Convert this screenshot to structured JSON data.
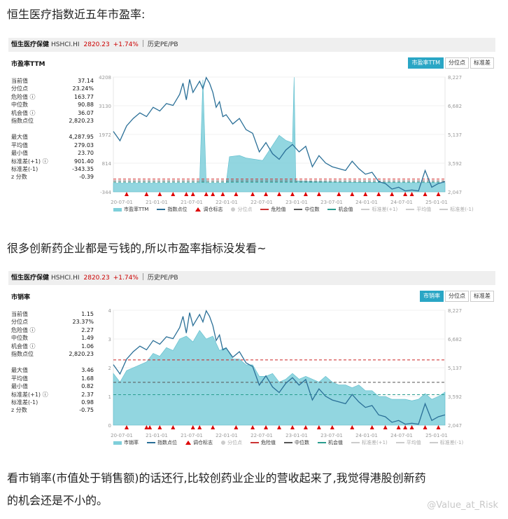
{
  "texts": {
    "heading1": "恒生医疗指数近五年市盈率:",
    "heading2": "很多创新药企业都是亏钱的,所以市盈率指标没发看~",
    "heading3a": "看市销率(市值处于销售额)的话还行,比较创药业企业的营收起来了,我觉得港股创新药",
    "heading3b": "的机会还是不小的。",
    "watermark": "@Value_at_Risk"
  },
  "colors": {
    "accent": "#2aa6c5",
    "index_line": "#2a6f97",
    "area": "#7fcfda",
    "danger": "#cc2222",
    "median": "#555555",
    "opportunity": "#2a9d8f",
    "up": "#cc0000"
  },
  "panels": [
    {
      "header": {
        "name": "恒生医疗保健",
        "code": "HSHCI.HI",
        "price": "2820.23",
        "change": "+1.74%",
        "history": "历史PE/PB"
      },
      "title": "市盈率TTM",
      "tabs": [
        "市盈率TTM",
        "分位点",
        "标准差"
      ],
      "stats_top": [
        {
          "k": "当前值",
          "v": "37.14"
        },
        {
          "k": "分位点",
          "v": "23.24%"
        },
        {
          "k": "危险值 ⓘ",
          "v": "163.77"
        },
        {
          "k": "中位数",
          "v": "90.88"
        },
        {
          "k": "机会值 ⓘ",
          "v": "36.07"
        },
        {
          "k": "指数点位",
          "v": "2,820.23"
        }
      ],
      "stats_bottom": [
        {
          "k": "最大值",
          "v": "4,287.95"
        },
        {
          "k": "平均值",
          "v": "279.03"
        },
        {
          "k": "最小值",
          "v": "23.70"
        },
        {
          "k": "标准差(+1) ⓘ",
          "v": "901.40"
        },
        {
          "k": "标准差(-1)",
          "v": "-343.35"
        },
        {
          "k": "z 分数",
          "v": "-0.39"
        }
      ],
      "legend": [
        "市盈率TTM",
        "指数点位",
        "调仓标志",
        "分位点",
        "危险值",
        "中位数",
        "机会值",
        "标准差(+1)",
        "平均值",
        "标准差(-1)"
      ],
      "chart_data": {
        "type": "line",
        "x_ticks": [
          "20-07-01",
          "21-01-01",
          "21-07-01",
          "22-01-01",
          "22-07-01",
          "23-01-01",
          "23-07-01",
          "24-01-01",
          "24-07-01",
          "25-01-01"
        ],
        "y_left_ticks": [
          "4208",
          "3130",
          "1972",
          "814",
          "-344"
        ],
        "y_right_ticks": [
          "8,227",
          "6,682",
          "5,137",
          "3,592",
          "2,047"
        ],
        "ylim": [
          -344,
          4208
        ],
        "ylim_index": [
          2047,
          8227
        ],
        "series": [
          {
            "name": "市盈率TTM",
            "kind": "area",
            "x": [
              0,
              0.05,
              0.1,
              0.15,
              0.2,
              0.25,
              0.26,
              0.27,
              0.28,
              0.3,
              0.32,
              0.34,
              0.35,
              0.38,
              0.4,
              0.45,
              0.5,
              0.52,
              0.54,
              0.545,
              0.55,
              0.6,
              0.7,
              0.8,
              0.9,
              0.95,
              1
            ],
            "y": [
              0,
              0,
              0,
              0,
              0,
              0,
              0,
              4100,
              0,
              0,
              0,
              0,
              1050,
              1100,
              1000,
              900,
              1900,
              1700,
              1600,
              4200,
              100,
              60,
              40,
              30,
              20,
              20,
              20
            ]
          },
          {
            "name": "指数点位",
            "kind": "line",
            "x": [
              0,
              0.02,
              0.04,
              0.06,
              0.08,
              0.1,
              0.12,
              0.14,
              0.16,
              0.18,
              0.2,
              0.21,
              0.22,
              0.23,
              0.24,
              0.26,
              0.27,
              0.28,
              0.29,
              0.3,
              0.31,
              0.32,
              0.33,
              0.34,
              0.36,
              0.38,
              0.4,
              0.42,
              0.44,
              0.46,
              0.48,
              0.5,
              0.52,
              0.54,
              0.56,
              0.58,
              0.6,
              0.62,
              0.64,
              0.66,
              0.68,
              0.7,
              0.72,
              0.74,
              0.76,
              0.78,
              0.8,
              0.82,
              0.84,
              0.86,
              0.88,
              0.9,
              0.92,
              0.94,
              0.96,
              0.98,
              1
            ],
            "y": [
              5300,
              4800,
              5600,
              6000,
              6300,
              6100,
              6600,
              6400,
              6800,
              6700,
              7300,
              7900,
              7000,
              8100,
              7400,
              8000,
              7600,
              8200,
              7900,
              7400,
              6600,
              6900,
              6100,
              6200,
              5700,
              6000,
              5400,
              5200,
              4200,
              4700,
              4100,
              3800,
              4300,
              4600,
              4200,
              4500,
              3400,
              4000,
              3600,
              3400,
              3300,
              3200,
              3700,
              3300,
              3000,
              3100,
              2600,
              2500,
              2200,
              2300,
              2100,
              2150,
              2100,
              3200,
              2300,
              2500,
              2600
            ]
          }
        ],
        "markers_x": [
          0.04,
          0.1,
          0.14,
          0.18,
          0.22,
          0.24,
          0.28,
          0.3,
          0.33,
          0.37,
          0.42,
          0.46,
          0.5,
          0.54,
          0.58,
          0.62,
          0.68,
          0.72,
          0.76,
          0.8,
          0.84,
          0.88,
          0.9,
          0.94,
          0.98
        ],
        "ref_lines": [
          {
            "name": "危险值",
            "y": 163.77
          },
          {
            "name": "中位数",
            "y": 90.88
          },
          {
            "name": "机会值",
            "y": 36.07
          }
        ]
      }
    },
    {
      "header": {
        "name": "恒生医疗保健",
        "code": "HSHCI.HI",
        "price": "2820.23",
        "change": "+1.74%",
        "history": "历史PE/PB"
      },
      "title": "市销率",
      "tabs": [
        "市销率",
        "分位点",
        "标准差"
      ],
      "stats_top": [
        {
          "k": "当前值",
          "v": "1.15"
        },
        {
          "k": "分位点",
          "v": "23.37%"
        },
        {
          "k": "危险值 ⓘ",
          "v": "2.27"
        },
        {
          "k": "中位数",
          "v": "1.49"
        },
        {
          "k": "机会值 ⓘ",
          "v": "1.06"
        },
        {
          "k": "指数点位",
          "v": "2,820.23"
        }
      ],
      "stats_bottom": [
        {
          "k": "最大值",
          "v": "3.46"
        },
        {
          "k": "平均值",
          "v": "1.68"
        },
        {
          "k": "最小值",
          "v": "0.82"
        },
        {
          "k": "标准差(+1) ⓘ",
          "v": "2.37"
        },
        {
          "k": "标准差(-1)",
          "v": "0.98"
        },
        {
          "k": "z 分数",
          "v": "-0.75"
        }
      ],
      "legend": [
        "市销率",
        "指数点位",
        "调仓标志",
        "分位点",
        "危险值",
        "中位数",
        "机会值",
        "标准差(+1)",
        "平均值",
        "标准差(-1)"
      ],
      "chart_data": {
        "type": "line",
        "x_ticks": [
          "20-07-01",
          "21-01-01",
          "21-07-01",
          "22-01-01",
          "22-07-01",
          "23-01-01",
          "23-07-01",
          "24-01-01",
          "24-07-01",
          "25-01-01"
        ],
        "y_left_ticks": [
          "4",
          "3",
          "2",
          "1",
          "0"
        ],
        "y_right_ticks": [
          "8,227",
          "6,682",
          "5,137",
          "3,592",
          "2,047"
        ],
        "ylim": [
          0,
          4
        ],
        "ylim_index": [
          2047,
          8227
        ],
        "series": [
          {
            "name": "市销率",
            "kind": "area",
            "x": [
              0,
              0.02,
              0.04,
              0.06,
              0.08,
              0.1,
              0.12,
              0.14,
              0.16,
              0.18,
              0.2,
              0.22,
              0.24,
              0.26,
              0.28,
              0.3,
              0.32,
              0.34,
              0.36,
              0.38,
              0.4,
              0.42,
              0.44,
              0.46,
              0.48,
              0.5,
              0.52,
              0.54,
              0.56,
              0.58,
              0.6,
              0.62,
              0.64,
              0.66,
              0.68,
              0.7,
              0.72,
              0.74,
              0.76,
              0.78,
              0.8,
              0.82,
              0.84,
              0.86,
              0.88,
              0.9,
              0.92,
              0.94,
              0.96,
              0.98,
              1
            ],
            "y": [
              1.8,
              1.5,
              1.9,
              2.0,
              2.1,
              2.2,
              2.5,
              2.4,
              2.7,
              2.6,
              3.0,
              3.1,
              2.9,
              3.3,
              3.0,
              3.1,
              2.6,
              2.7,
              2.3,
              2.3,
              2.1,
              2.1,
              1.7,
              1.7,
              1.8,
              1.5,
              1.6,
              1.8,
              1.6,
              1.7,
              1.6,
              1.5,
              1.7,
              1.5,
              1.4,
              1.4,
              1.3,
              1.4,
              1.2,
              1.2,
              1.0,
              1.0,
              0.9,
              0.9,
              0.9,
              0.85,
              0.9,
              1.1,
              0.9,
              1.0,
              1.15
            ]
          },
          {
            "name": "指数点位",
            "kind": "line",
            "x": [
              0,
              0.02,
              0.04,
              0.06,
              0.08,
              0.1,
              0.12,
              0.14,
              0.16,
              0.18,
              0.2,
              0.21,
              0.22,
              0.23,
              0.24,
              0.26,
              0.27,
              0.28,
              0.29,
              0.3,
              0.31,
              0.32,
              0.33,
              0.34,
              0.36,
              0.38,
              0.4,
              0.42,
              0.44,
              0.46,
              0.48,
              0.5,
              0.52,
              0.54,
              0.56,
              0.58,
              0.6,
              0.62,
              0.64,
              0.66,
              0.68,
              0.7,
              0.72,
              0.74,
              0.76,
              0.78,
              0.8,
              0.82,
              0.84,
              0.86,
              0.88,
              0.9,
              0.92,
              0.94,
              0.96,
              0.98,
              1
            ],
            "y": [
              5300,
              4800,
              5600,
              6000,
              6300,
              6100,
              6600,
              6400,
              6800,
              6700,
              7300,
              7900,
              7000,
              8100,
              7400,
              8000,
              7600,
              8200,
              7900,
              7400,
              6600,
              6900,
              6100,
              6200,
              5700,
              6000,
              5400,
              5200,
              4200,
              4700,
              4100,
              3800,
              4300,
              4600,
              4200,
              4500,
              3400,
              4000,
              3600,
              3400,
              3300,
              3200,
              3700,
              3300,
              3000,
              3100,
              2600,
              2500,
              2200,
              2300,
              2100,
              2150,
              2100,
              3200,
              2300,
              2500,
              2600
            ]
          }
        ],
        "markers_x": [
          0.04,
          0.1,
          0.11,
          0.14,
          0.18,
          0.24,
          0.26,
          0.3,
          0.37,
          0.42,
          0.46,
          0.5,
          0.54,
          0.58,
          0.62,
          0.66,
          0.72,
          0.78,
          0.82,
          0.86,
          0.88,
          0.9,
          0.94,
          0.98
        ],
        "ref_lines": [
          {
            "name": "危险值",
            "y": 2.27
          },
          {
            "name": "中位数",
            "y": 1.49
          },
          {
            "name": "机会值",
            "y": 1.06
          }
        ]
      }
    }
  ]
}
